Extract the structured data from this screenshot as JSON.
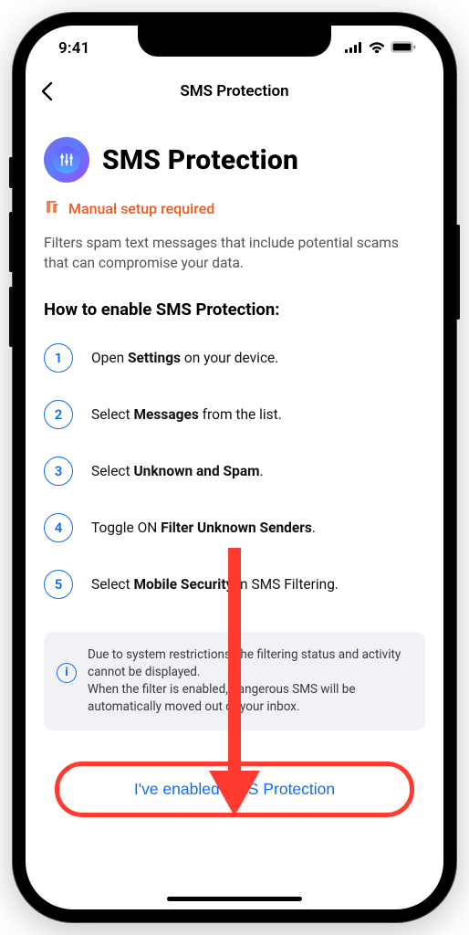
{
  "status": {
    "time": "9:41"
  },
  "nav": {
    "title": "SMS Protection"
  },
  "hero": {
    "title": "SMS Protection"
  },
  "warning": {
    "text": "Manual setup required"
  },
  "desc": "Filters spam text messages that include potential scams that can compromise your data.",
  "howto_title": "How to enable SMS Protection:",
  "steps": [
    {
      "num": "1",
      "pre": "Open ",
      "bold": "Settings",
      "post": " on your device."
    },
    {
      "num": "2",
      "pre": "Select ",
      "bold": "Messages",
      "post": " from the list."
    },
    {
      "num": "3",
      "pre": "Select ",
      "bold": "Unknown and Spam",
      "post": "."
    },
    {
      "num": "4",
      "pre": "Toggle ON ",
      "bold": "Filter Unknown Senders",
      "post": "."
    },
    {
      "num": "5",
      "pre": "Select ",
      "bold": "Mobile Security",
      "post": " in SMS Filtering."
    }
  ],
  "info": {
    "line1": "Due to system restrictions, the filtering status and activity cannot be displayed.",
    "line2": "When the filter is enabled, dangerous SMS will be automatically moved out of your inbox."
  },
  "cta": {
    "label": "I've enabled SMS Protection"
  },
  "colors": {
    "accent": "#0b6cff",
    "warning": "#f05a1c",
    "highlight": "#ff3b2f"
  }
}
